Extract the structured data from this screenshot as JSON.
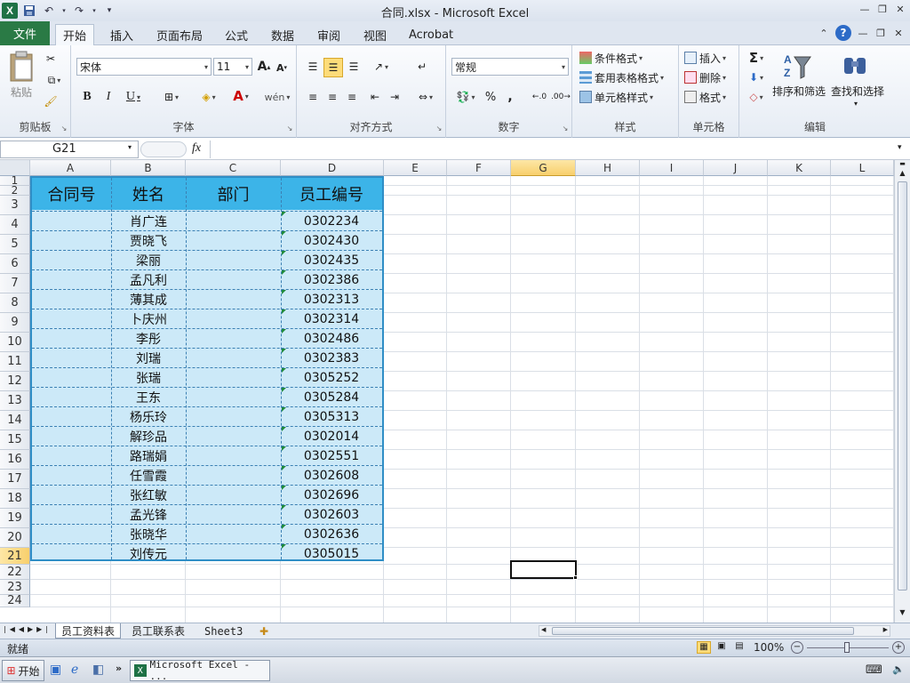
{
  "window": {
    "title": "合同.xlsx - Microsoft Excel",
    "app_icon": "X"
  },
  "tabs": {
    "file": "文件",
    "items": [
      "开始",
      "插入",
      "页面布局",
      "公式",
      "数据",
      "审阅",
      "视图",
      "Acrobat"
    ],
    "active": "开始"
  },
  "ribbon": {
    "clipboard": {
      "label": "剪贴板",
      "paste": "粘贴"
    },
    "font": {
      "label": "字体",
      "name": "宋体",
      "size": "11"
    },
    "alignment": {
      "label": "对齐方式"
    },
    "number": {
      "label": "数字",
      "format": "常规",
      "percent": "%",
      "comma": ","
    },
    "styles": {
      "label": "样式",
      "conditional": "条件格式",
      "table": "套用表格格式",
      "cell": "单元格样式"
    },
    "cells": {
      "label": "单元格",
      "insert": "插入",
      "delete": "删除",
      "format": "格式"
    },
    "editing": {
      "label": "编辑",
      "sort": "排序和筛选",
      "find": "查找和选择"
    }
  },
  "formula_bar": {
    "name_box": "G21",
    "fx": "fx",
    "content": ""
  },
  "columns": [
    "A",
    "B",
    "C",
    "D",
    "E",
    "F",
    "G",
    "H",
    "I",
    "J",
    "K",
    "L"
  ],
  "rows": [
    "1",
    "2",
    "3",
    "4",
    "5",
    "6",
    "7",
    "8",
    "9",
    "10",
    "11",
    "12",
    "13",
    "14",
    "15",
    "16",
    "17",
    "18",
    "19",
    "20",
    "21",
    "22",
    "23",
    "24"
  ],
  "table": {
    "headers": [
      "合同号",
      "姓名",
      "部门",
      "员工编号"
    ],
    "rows": [
      {
        "name": "肖广连",
        "id": "0302234"
      },
      {
        "name": "贾晓飞",
        "id": "0302430"
      },
      {
        "name": "梁丽",
        "id": "0302435"
      },
      {
        "name": "孟凡利",
        "id": "0302386"
      },
      {
        "name": "薄其成",
        "id": "0302313"
      },
      {
        "name": "卜庆州",
        "id": "0302314"
      },
      {
        "name": "李彤",
        "id": "0302486"
      },
      {
        "name": "刘瑞",
        "id": "0302383"
      },
      {
        "name": "张瑞",
        "id": "0305252"
      },
      {
        "name": "王东",
        "id": "0305284"
      },
      {
        "name": "杨乐玲",
        "id": "0305313"
      },
      {
        "name": "解珍品",
        "id": "0302014"
      },
      {
        "name": "路瑞娟",
        "id": "0302551"
      },
      {
        "name": "任雪霞",
        "id": "0302608"
      },
      {
        "name": "张红敏",
        "id": "0302696"
      },
      {
        "name": "孟光锋",
        "id": "0302603"
      },
      {
        "name": "张晓华",
        "id": "0302636"
      },
      {
        "name": "刘传元",
        "id": "0305015"
      }
    ]
  },
  "sheets": [
    "员工资料表",
    "员工联系表",
    "Sheet3"
  ],
  "active_sheet": "员工资料表",
  "status": {
    "ready": "就绪",
    "zoom": "100%"
  },
  "taskbar": {
    "start": "开始",
    "item": "Microsoft Excel - ..."
  },
  "colors": {
    "accent": "#2a7a45",
    "table_header": "#3cb4e8",
    "table_body": "#cce9f8",
    "table_border": "#2f8ec6"
  }
}
